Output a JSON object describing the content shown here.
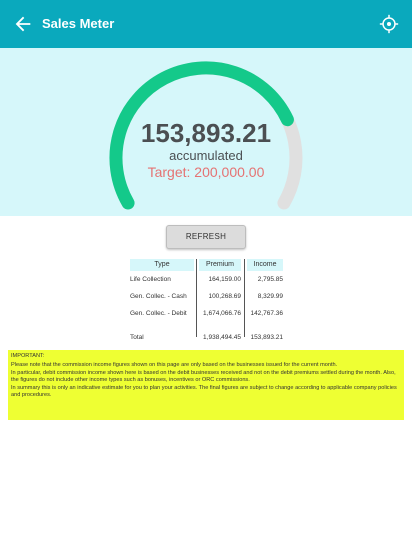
{
  "appbar": {
    "title": "Sales Meter",
    "back_icon": "arrow-back-icon",
    "action_icon": "crosshair-target-icon"
  },
  "meter": {
    "accumulated_value": "153,893.21",
    "accumulated_label": "accumulated",
    "target_label": "Target: 200,000.00",
    "progress_fraction": 0.77,
    "colors": {
      "progress": "#14c98a",
      "track": "#e0e0e0",
      "background": "#d6f7fa",
      "target_text": "#e57373"
    }
  },
  "refresh_label": "REFRESH",
  "table": {
    "headers": [
      "Type",
      "Premium",
      "Income"
    ],
    "rows": [
      {
        "type": "Life Collection",
        "premium": "164,159.00",
        "income": "2,795.85"
      },
      {
        "type": "Gen. Collec. - Cash",
        "premium": "100,268.69",
        "income": "8,329.99"
      },
      {
        "type": "Gen. Collec. - Debit",
        "premium": "1,674,066.76",
        "income": "142,767.36"
      }
    ],
    "total": {
      "label": "Total",
      "premium": "1,938,494.45",
      "income": "153,893.21"
    }
  },
  "notice": {
    "heading": "IMPORTANT:",
    "p1": "Please note that the commission income figures shown on this page are only based on the businesses issued for the current month.",
    "p2": "In particular, debit commission income shown here is based on the debit businesses received and not on the debit premiums settled during the month. Also, the figures do not include other income types such as bonuses, incentives or ORC commissions.",
    "p3": "In summary this is only an indicative estimate for you to plan your activities. The final figures are subject to change according to applicable company policies and procedures."
  }
}
